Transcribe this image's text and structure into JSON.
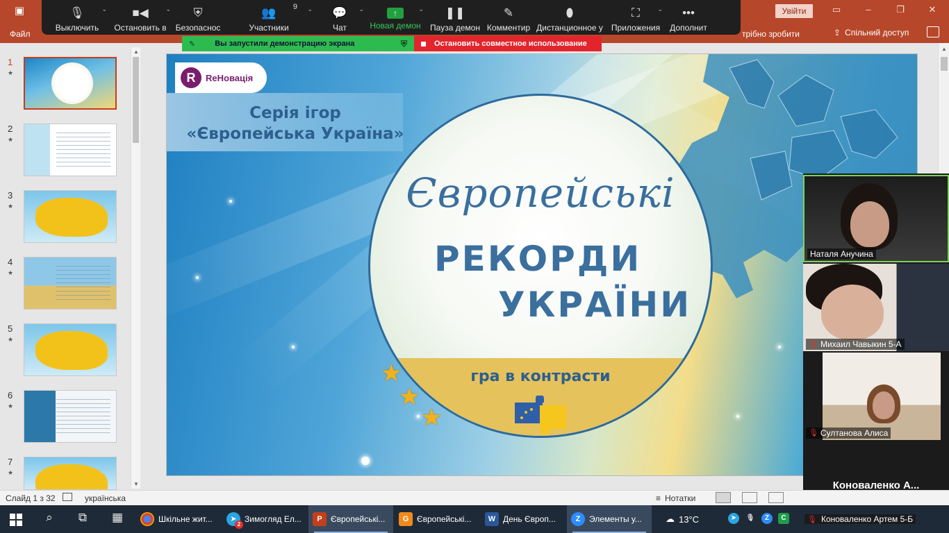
{
  "ppt": {
    "file_tab": "Файл",
    "tabs_right_text": "трібно зробити",
    "share_button": "Спільний доступ",
    "login_button": "Увійти"
  },
  "zoom_toolbar": {
    "items": [
      {
        "label": "Выключить",
        "icon": "microphone-icon"
      },
      {
        "label": "Остановить в",
        "icon": "video-camera-icon"
      },
      {
        "label": "Безопаснос",
        "icon": "shield-icon"
      },
      {
        "label": "Участники",
        "icon": "participants-icon",
        "count": "9"
      },
      {
        "label": "Чат",
        "icon": "chat-icon"
      },
      {
        "label": "Новая демон",
        "icon": "share-screen-icon"
      },
      {
        "label": "Пауза демон",
        "icon": "pause-icon"
      },
      {
        "label": "Комментир",
        "icon": "pencil-icon"
      },
      {
        "label": "Дистанционное у",
        "icon": "mouse-icon"
      },
      {
        "label": "Приложения",
        "icon": "apps-icon"
      },
      {
        "label": "Дополнит",
        "icon": "more-icon"
      }
    ],
    "sharing_banner": "Вы запустили демонстрацию экрана",
    "stop_sharing": "Остановить совместное использование",
    "colors": {
      "toolbar_bg": "#1f1f1f",
      "active_green": "#38c75b",
      "banner_green": "#2dbb4f",
      "banner_red": "#e2252c"
    }
  },
  "thumbnails": [
    {
      "num": "1",
      "star": "★"
    },
    {
      "num": "2",
      "star": "★"
    },
    {
      "num": "3",
      "star": "★"
    },
    {
      "num": "4",
      "star": "★"
    },
    {
      "num": "5",
      "star": "★"
    },
    {
      "num": "6",
      "star": "★"
    },
    {
      "num": "7",
      "star": "★"
    }
  ],
  "slide": {
    "logo_letter": "R",
    "logo_text": "ReНовація",
    "series_line1": "Серія ігор",
    "series_line2": "«Європейська Україна»",
    "title_script": "Європейські",
    "title_line1": "РЕКОРДИ",
    "title_line2": "УКРАЇНИ",
    "subtitle": "гра в контрасти"
  },
  "participants": [
    {
      "name": "Наталя Анучина",
      "muted": false,
      "speaking": true
    },
    {
      "name": "Михаил Чавыкин 5-А",
      "muted": true
    },
    {
      "name": "Султанова Алиса",
      "muted": true
    },
    {
      "name": "Коноваленко  А...",
      "no_video": true
    }
  ],
  "status_bar": {
    "slide_info": "Слайд 1 з 32",
    "language": "українська",
    "notes": "Нотатки"
  },
  "taskbar": {
    "apps": [
      {
        "label": "Шкільне жит...",
        "icon": "chrome-icon"
      },
      {
        "label": "Зимогляд Ел...",
        "icon": "telegram-icon",
        "badge": "2"
      },
      {
        "label": "Європейські...",
        "icon": "powerpoint-icon",
        "active": true
      },
      {
        "label": "Європейські...",
        "icon": "pdf-reader-icon"
      },
      {
        "label": "День Європ...",
        "icon": "word-icon"
      },
      {
        "label": "Элементы у...",
        "icon": "zoom-app-icon",
        "active": true
      }
    ],
    "temperature": "13°C",
    "tray_user": "Коноваленко Артем 5-Б"
  }
}
